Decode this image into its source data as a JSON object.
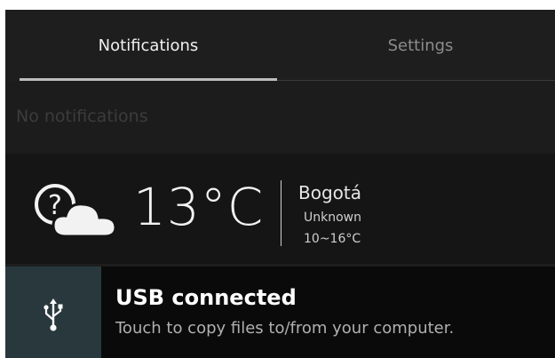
{
  "tabs": {
    "notifications": "Notifications",
    "settings": "Settings"
  },
  "notifications": {
    "empty": "No notifications"
  },
  "weather": {
    "icon": "unknown-weather-icon",
    "temperature": "13°C",
    "city": "Bogotá",
    "condition": "Unknown",
    "range": "10~16°C"
  },
  "usb": {
    "icon": "usb-icon",
    "title": "USB connected",
    "subtitle": "Touch to copy files to/from your computer."
  },
  "colors": {
    "background": "#1e1e1e",
    "usb_icon_bg": "#28383d",
    "tab_indicator": "#bdbdbd"
  }
}
